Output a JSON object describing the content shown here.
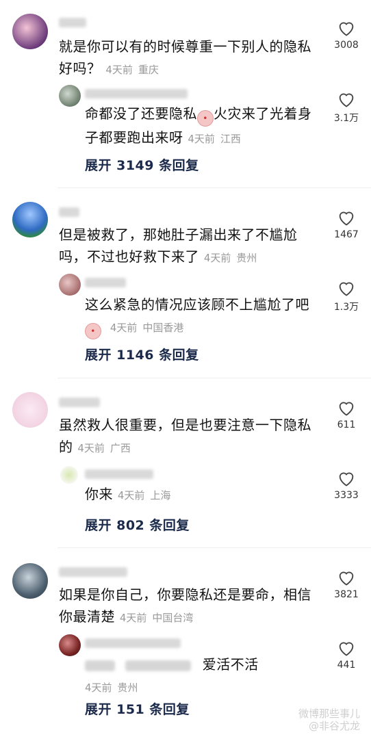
{
  "threads": [
    {
      "comment": {
        "text": "就是你可以有的时候尊重一下别人的隐私好吗？",
        "time": "4天前",
        "location": "重庆",
        "likes": "3008"
      },
      "reply": {
        "text": "命都没了还要隐私",
        "emoji": "😰",
        "text2": "火灾来了光着身子都要跑出来呀",
        "time": "4天前",
        "location": "江西",
        "likes": "3.1万"
      },
      "expand": "展开 3149 条回复"
    },
    {
      "comment": {
        "text": "但是被救了，那她肚子漏出来了不尴尬吗，不过也好救下来了",
        "time": "4天前",
        "location": "贵州",
        "likes": "1467"
      },
      "reply": {
        "text": "这么紧急的情况应该顾不上尴尬了吧",
        "emoji": "😰",
        "time": "4天前",
        "location": "中国香港",
        "likes": "1.3万"
      },
      "expand": "展开 1146 条回复"
    },
    {
      "comment": {
        "text": "虽然救人很重要，但是也要注意一下隐私的",
        "time": "4天前",
        "location": "广西",
        "likes": "611"
      },
      "reply": {
        "text": "你来",
        "time": "4天前",
        "location": "上海",
        "likes": "3333"
      },
      "expand": "展开 802 条回复"
    },
    {
      "comment": {
        "text": "如果是你自己，你要隐私还是要命，相信你最清楚",
        "time": "4天前",
        "location": "中国台湾",
        "likes": "3821"
      },
      "reply": {
        "text": "爱活不活",
        "time": "4天前",
        "location": "贵州",
        "likes": "441"
      },
      "expand": "展开 151 条回复"
    }
  ],
  "watermark": {
    "line1": "微博那些事儿",
    "line2": "@非谷尤龙"
  },
  "icons": {
    "like": "heart-outline-icon"
  }
}
